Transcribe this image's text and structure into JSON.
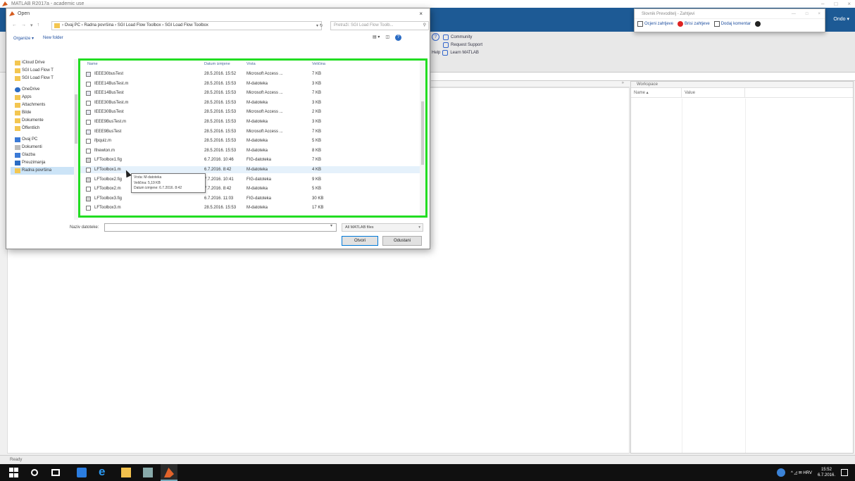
{
  "matlab": {
    "title": "MATLAB R2017a - academic use",
    "win_controls": [
      "–",
      "□",
      "×"
    ],
    "search_help": "Ondo ▾",
    "ribbon": {
      "community": "Community",
      "request_support": "Request Support",
      "learn": "Learn MATLAB",
      "help_label": "Help"
    },
    "panel_header": "»",
    "status": "Ready"
  },
  "workspace": {
    "header": "Workspace",
    "col_name": "Name ▴",
    "col_value": "Value"
  },
  "popup": {
    "title": "Slovnik Prevoditelj - Zahtjevi",
    "controls": [
      "—",
      "□",
      "×"
    ],
    "items": [
      {
        "label": "Ocjeni zahtjeve"
      },
      {
        "label": "Brisi zahtjeve"
      },
      {
        "label": "Dodaj komentar"
      }
    ]
  },
  "dialog": {
    "title": "Open",
    "close": "×",
    "nav": [
      "←",
      "→",
      "▾",
      "↑"
    ],
    "address": "› Ovaj PC › Radna površina › SGI Load Flow Toolbox › SGI Load Flow Toolbox",
    "address_end": "▾ ↻",
    "search_placeholder": "Pretraži: SGI Load Flow Toolb...",
    "search_icon": "⚲",
    "organize": "Organize ▾",
    "new_folder": "New folder",
    "view_controls": [
      "▤ ▾",
      "◫"
    ],
    "help": "?",
    "sidebar": [
      {
        "label": "iCloud Drive",
        "icon": "folder"
      },
      {
        "label": "SGI Load Flow T",
        "icon": "folder"
      },
      {
        "label": "SGI Load Flow T",
        "icon": "folder"
      },
      {
        "label": "OneDrive",
        "icon": "cloud",
        "gap": true
      },
      {
        "label": "Apps",
        "icon": "folder"
      },
      {
        "label": "Attachments",
        "icon": "folder"
      },
      {
        "label": "Bilde",
        "icon": "folder"
      },
      {
        "label": "Dokumente",
        "icon": "folder"
      },
      {
        "label": "Öffentlich",
        "icon": "folder"
      },
      {
        "label": "Ovaj PC",
        "icon": "pc",
        "gap": true
      },
      {
        "label": "Dokumenti",
        "icon": "doc"
      },
      {
        "label": "Glazba",
        "icon": "music"
      },
      {
        "label": "Preuzimanja",
        "icon": "dl"
      },
      {
        "label": "Radna površina",
        "icon": "folder",
        "selected": true
      }
    ],
    "columns": {
      "name": "Name",
      "date": "Datum izmjene",
      "type": "Vrsta",
      "size": "Veličina"
    },
    "files": [
      {
        "name": "IEEE30busTest",
        "icon": "mat",
        "date": "28.5.2016. 15:52",
        "type": "Microsoft Access ...",
        "size": "7 KB"
      },
      {
        "name": "IEEE14BusTest.m",
        "icon": "m",
        "date": "28.5.2016. 15:53",
        "type": "M-datoteka",
        "size": "3 KB"
      },
      {
        "name": "IEEE14BusTest",
        "icon": "mat",
        "date": "28.5.2016. 15:53",
        "type": "Microsoft Access ...",
        "size": "7 KB"
      },
      {
        "name": "IEEE30BusTest.m",
        "icon": "m",
        "date": "28.5.2016. 15:53",
        "type": "M-datoteka",
        "size": "3 KB"
      },
      {
        "name": "IEEE30BusTest",
        "icon": "mat",
        "date": "28.5.2016. 15:53",
        "type": "Microsoft Access ...",
        "size": "2 KB"
      },
      {
        "name": "IEEE9BusTest.m",
        "icon": "m",
        "date": "28.5.2016. 15:53",
        "type": "M-datoteka",
        "size": "3 KB"
      },
      {
        "name": "IEEE9BusTest",
        "icon": "mat",
        "date": "28.5.2016. 15:53",
        "type": "Microsoft Access ...",
        "size": "7 KB"
      },
      {
        "name": "ifpquiz.m",
        "icon": "m",
        "date": "28.5.2016. 15:53",
        "type": "M-datoteka",
        "size": "5 KB"
      },
      {
        "name": "lfnewton.m",
        "icon": "m",
        "date": "28.5.2016. 15:53",
        "type": "M-datoteka",
        "size": "8 KB"
      },
      {
        "name": "LFToolbox1.fig",
        "icon": "fig",
        "date": "6.7.2016. 10:46",
        "type": "FIG-datoteka",
        "size": "7 KB"
      },
      {
        "name": "LFToolbox1.m",
        "icon": "m",
        "date": "6.7.2016. 8:42",
        "type": "M-datoteka",
        "size": "4 KB",
        "highlight": true
      },
      {
        "name": "LFToolbox2.fig",
        "icon": "fig",
        "date": "7.7.2016. 10:41",
        "type": "FIG-datoteka",
        "size": "9 KB"
      },
      {
        "name": "LFToolbox2.m",
        "icon": "m",
        "date": "7.7.2016. 8:42",
        "type": "M-datoteka",
        "size": "5 KB"
      },
      {
        "name": "LFToolbox3.fig",
        "icon": "fig",
        "date": "6.7.2016. 11:03",
        "type": "FIG-datoteka",
        "size": "30 KB"
      },
      {
        "name": "LFToolbox3.m",
        "icon": "m",
        "date": "28.5.2016. 15:53",
        "type": "M-datoteka",
        "size": "17 KB"
      }
    ],
    "tooltip": {
      "type": "Vrsta: M-datoteka",
      "size": "Veličina: 5,19 KB",
      "date": "Datum izmjene: 6.7.2016. 8:42"
    },
    "filename_label": "Naziv datoteke:",
    "filename_value": "",
    "filename_dropdown": "▾",
    "filetype": "All MATLAB files",
    "filetype_arrow": "▾",
    "open_label": "Otvori",
    "cancel_label": "Odustani"
  },
  "tray": {
    "icons": "^ ◿ ✉ HRV",
    "time": "15:52",
    "date": "6.7.2016."
  }
}
